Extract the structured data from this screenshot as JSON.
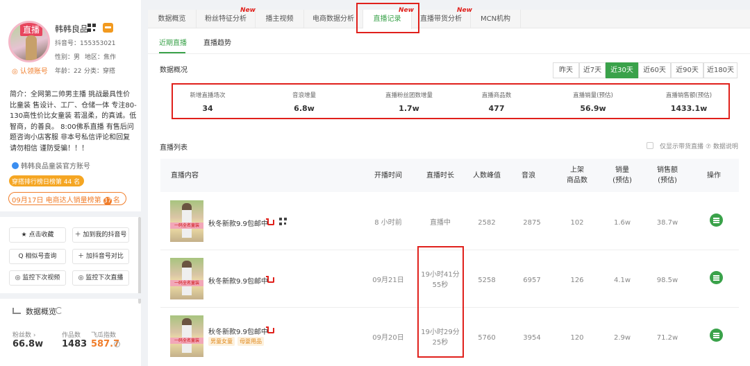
{
  "profile": {
    "avatar_tag": "直播",
    "name": "韩韩良品",
    "douyin_id": "抖音号：155353021",
    "gender": "性别：男",
    "region": "地区：焦作",
    "claim": "◎ 认领账号",
    "age": "年龄：22",
    "category": "分类：穿搭",
    "bio": "简介：全网第二帅男主播 挑战最具性价比童装 售设计、工厂、仓储一体 专注80-130高性价比女童装 若温柔，的真诚。低智商，的善良。 8:00佛系直播 有售后问题咨询小店客服 非本号私信评论和回复 请勿相信 谨防受骗！！！",
    "official": "韩韩良品童装官方账号",
    "rank1": "穿搭排行榜日榜第 44 名",
    "rank2_prefix": "09月17日 电商达人销量榜第",
    "rank2_num": "37",
    "rank2_suffix": "名",
    "buttons": [
      "★ 点击收藏",
      "＋ 加到我的抖音号",
      "Q 相似号查询",
      "＋ 加抖音号对比",
      "◎ 监控下次视频",
      "◎ 监控下次直播"
    ],
    "overview_title": "数据概览",
    "stats": [
      {
        "label": "粉丝数 ›",
        "value": "66.8w"
      },
      {
        "label": "作品数",
        "value": "1483"
      },
      {
        "label": "飞瓜指数",
        "value": "587.7"
      }
    ]
  },
  "tabs": {
    "items": [
      "数据概览",
      "粉丝特征分析",
      "播主视频",
      "电商数据分析",
      "直播记录",
      "直播带货分析",
      "MCN机构"
    ],
    "new_label": "New",
    "active": "直播记录"
  },
  "subtabs": [
    "近期直播",
    "直播趋势"
  ],
  "overview": {
    "title": "数据概况",
    "ranges": [
      "昨天",
      "近7天",
      "近30天",
      "近60天",
      "近90天",
      "近180天"
    ],
    "active_range": "近30天",
    "kpis": [
      {
        "label": "新增直播场次",
        "value": "34"
      },
      {
        "label": "音浪增量",
        "value": "6.8w"
      },
      {
        "label": "直播粉丝团数增量",
        "value": "1.7w"
      },
      {
        "label": "直播商品数",
        "value": "477"
      },
      {
        "label": "直播销量(预估)",
        "value": "56.9w"
      },
      {
        "label": "直播销售额(预估)",
        "value": "1433.1w"
      }
    ]
  },
  "list": {
    "title": "直播列表",
    "only_goods": "仅显示带货直播",
    "data_note": "⑦ 数据说明",
    "headers": {
      "content": "直播内容",
      "start": "开播时间",
      "duration": "直播时长",
      "peak": "人数峰值",
      "sound": "音浪",
      "goods": "上架\n商品数",
      "sales": "销量\n(预估)",
      "revenue": "销售额\n(预估)",
      "op": "操作"
    },
    "thumb_text": "一码全名童装",
    "rows": [
      {
        "name": "秋冬新款9.9包邮中",
        "start": "8 小时前",
        "duration": "直播中",
        "peak": "2582",
        "sound": "2875",
        "goods": "102",
        "sales": "1.6w",
        "revenue": "38.7w"
      },
      {
        "name": "秋冬新款9.9包邮中",
        "start": "09月21日",
        "duration": "19小时41分\n55秒",
        "peak": "5258",
        "sound": "6957",
        "goods": "126",
        "sales": "4.1w",
        "revenue": "98.5w"
      },
      {
        "name": "秋冬新款9.9包邮中",
        "start": "09月20日",
        "duration": "19小时29分\n25秒",
        "peak": "5760",
        "sound": "3954",
        "goods": "120",
        "sales": "2.9w",
        "revenue": "71.2w",
        "chips": [
          "男童女童",
          "母婴用品"
        ]
      }
    ]
  },
  "colors": {
    "accent": "#3aa24a",
    "highlight": "#e0201b",
    "orange": "#f07d2a"
  }
}
